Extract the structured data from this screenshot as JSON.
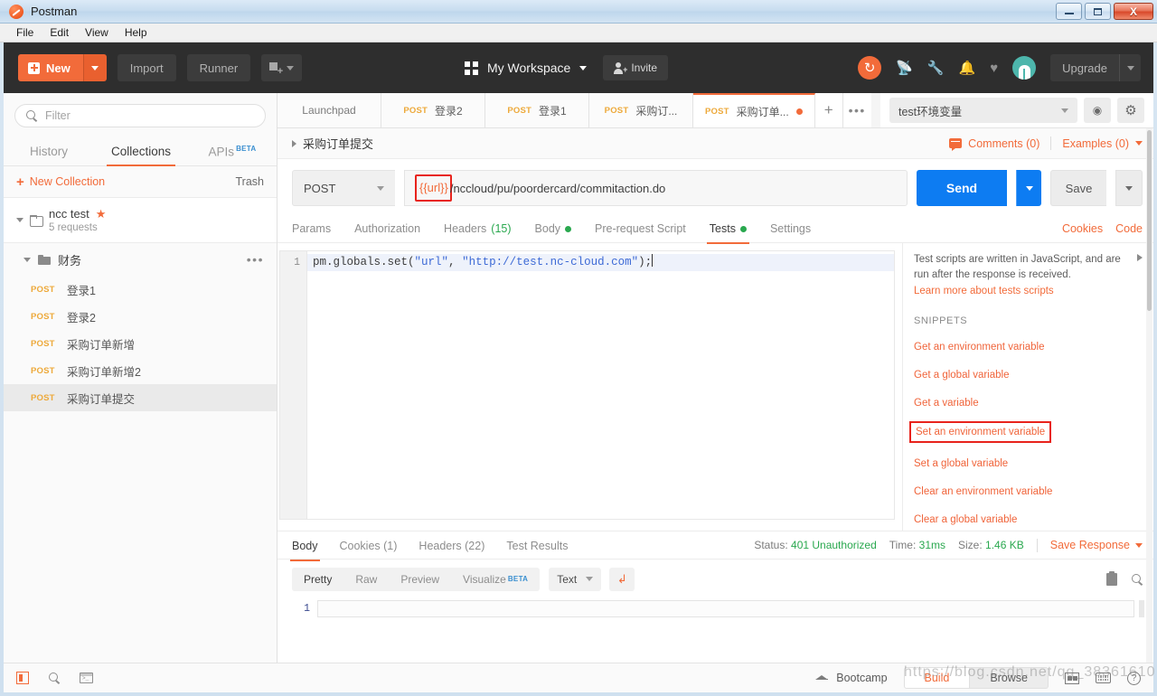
{
  "window": {
    "app_title": "Postman",
    "logo_icon": "postman-logo-icon",
    "minimize_label": "",
    "maximize_label": "",
    "close_label": "X"
  },
  "menubar": {
    "items": [
      {
        "label": "File"
      },
      {
        "label": "Edit"
      },
      {
        "label": "View"
      },
      {
        "label": "Help"
      }
    ]
  },
  "topbar": {
    "new_label": "New",
    "import_label": "Import",
    "runner_label": "Runner",
    "new_tab_icon": "new-tab-icon",
    "workspace_icon": "grid-icon",
    "workspace_label": "My Workspace",
    "invite_label": "Invite",
    "invite_icon": "person-add-icon",
    "sync_icon": "sync-icon",
    "sync_glyph": "↻",
    "satellite_icon": "satellite-icon",
    "satellite_glyph": "📡",
    "wrench_icon": "wrench-icon",
    "wrench_glyph": "🔧",
    "bell_icon": "bell-icon",
    "bell_glyph": "🔔",
    "heart_icon": "heart-icon",
    "heart_glyph": "♥",
    "avatar_icon": "user-avatar",
    "upgrade_label": "Upgrade",
    "accent_orange": "#f26b3a",
    "dark_bg": "#2e2e2e"
  },
  "sidebar": {
    "filter_placeholder": "Filter",
    "filter_value": "",
    "search_icon": "search-icon",
    "tabs": [
      {
        "label": "History",
        "active": false
      },
      {
        "label": "Collections",
        "active": true
      },
      {
        "label": "APIs",
        "active": false,
        "badge": "BETA"
      }
    ],
    "new_collection_label": "New Collection",
    "trash_label": "Trash",
    "collection": {
      "name": "ncc test",
      "starred_icon": "star-icon",
      "sub": "5 requests",
      "folder_icon": "folder-icon",
      "expand_icon": "chevron-down-icon"
    },
    "folder": {
      "name": "财务",
      "folder_icon": "folder-filled-icon",
      "more_icon": "more-horizontal-icon"
    },
    "requests": [
      {
        "method": "POST",
        "name": "登录1",
        "selected": false
      },
      {
        "method": "POST",
        "name": "登录2",
        "selected": false
      },
      {
        "method": "POST",
        "name": "采购订单新增",
        "selected": false
      },
      {
        "method": "POST",
        "name": "采购订单新增2",
        "selected": false
      },
      {
        "method": "POST",
        "name": "采购订单提交",
        "selected": true
      }
    ]
  },
  "tabstrip": {
    "tabs": [
      {
        "label": "Launchpad",
        "method": "",
        "active": false,
        "unsaved": false
      },
      {
        "label": "登录2",
        "method": "POST",
        "active": false,
        "unsaved": false
      },
      {
        "label": "登录1",
        "method": "POST",
        "active": false,
        "unsaved": false
      },
      {
        "label": "采购订...",
        "method": "POST",
        "active": false,
        "unsaved": false
      },
      {
        "label": "采购订单...",
        "method": "POST",
        "active": true,
        "unsaved": true
      }
    ],
    "add_tab_label": "+",
    "more_tabs_label": "•••",
    "environment_value": "test环境变量",
    "eye_icon": "eye-icon",
    "eye_glyph": "◉",
    "gear_icon": "gear-icon",
    "gear_glyph": "⚙"
  },
  "request": {
    "breadcrumb_title": "采购订单提交",
    "expand_icon": "chevron-right-icon",
    "comments_label": "Comments (0)",
    "comments_icon": "comment-icon",
    "examples_label": "Examples (0)",
    "method": "POST",
    "url_variable": "{{url}}",
    "url_rest": "/nccloud/pu/poordercard/commitaction.do",
    "url_full": "{{url}}/nccloud/pu/poordercard/commitaction.do",
    "highlight_color": "#e8231c",
    "send_label": "Send",
    "save_label": "Save",
    "tabs": [
      {
        "label": "Params",
        "active": false,
        "count": "",
        "dot": false
      },
      {
        "label": "Authorization",
        "active": false,
        "count": "",
        "dot": false
      },
      {
        "label": "Headers",
        "active": false,
        "count": "(15)",
        "dot": false
      },
      {
        "label": "Body",
        "active": false,
        "count": "",
        "dot": true
      },
      {
        "label": "Pre-request Script",
        "active": false,
        "count": "",
        "dot": false
      },
      {
        "label": "Tests",
        "active": true,
        "count": "",
        "dot": true
      },
      {
        "label": "Settings",
        "active": false,
        "count": "",
        "dot": false
      }
    ],
    "cookies_label": "Cookies",
    "code_label": "Code"
  },
  "editor": {
    "line_numbers": [
      "1"
    ],
    "code_prefix": "pm.globals.set(",
    "code_arg1": "\"url\"",
    "code_comma": ", ",
    "code_arg2": "\"http://test.nc-cloud.com\"",
    "code_suffix": ");",
    "full_line": "pm.globals.set(\"url\", \"http://test.nc-cloud.com\");"
  },
  "snippets": {
    "help_text": "Test scripts are written in JavaScript, and are run after the response is received.",
    "learn_more": "Learn more about tests scripts",
    "section_title": "SNIPPETS",
    "collapse_icon": "chevron-right-icon",
    "items": [
      {
        "label": "Get an environment variable",
        "boxed": false
      },
      {
        "label": "Get a global variable",
        "boxed": false
      },
      {
        "label": "Get a variable",
        "boxed": false
      },
      {
        "label": "Set an environment variable",
        "boxed": true
      },
      {
        "label": "Set a global variable",
        "boxed": false
      },
      {
        "label": "Clear an environment variable",
        "boxed": false
      },
      {
        "label": "Clear a global variable",
        "boxed": false
      }
    ]
  },
  "response": {
    "tabs": [
      {
        "label": "Body",
        "active": true
      },
      {
        "label": "Cookies (1)",
        "active": false
      },
      {
        "label": "Headers (22)",
        "active": false
      },
      {
        "label": "Test Results",
        "active": false
      }
    ],
    "status_label": "Status:",
    "status_value": "401 Unauthorized",
    "time_label": "Time:",
    "time_value": "31ms",
    "size_label": "Size:",
    "size_value": "1.46 KB",
    "save_response_label": "Save Response",
    "view_modes": [
      {
        "label": "Pretty",
        "active": true
      },
      {
        "label": "Raw",
        "active": false
      },
      {
        "label": "Preview",
        "active": false
      },
      {
        "label": "Visualize",
        "active": false,
        "badge": "BETA"
      }
    ],
    "format_value": "Text",
    "wrap_icon": "word-wrap-icon",
    "wrap_glyph": "↲",
    "copy_icon": "copy-icon",
    "search_icon": "search-icon",
    "body_line_numbers": [
      "1"
    ],
    "body_content": ""
  },
  "statusbar": {
    "sidebar_toggle_icon": "sidebar-panel-icon",
    "find_icon": "search-icon",
    "console_icon": "console-icon",
    "bootcamp_label": "Bootcamp",
    "bootcamp_icon": "graduation-cap-icon",
    "build_label": "Build",
    "browse_label": "Browse",
    "two_pane_icon": "two-pane-icon",
    "keyboard_icon": "keyboard-icon",
    "help_icon": "help-circle-icon",
    "help_glyph": "?"
  },
  "watermark": {
    "text": "https://blog.csdn.net/qq_38361610"
  }
}
